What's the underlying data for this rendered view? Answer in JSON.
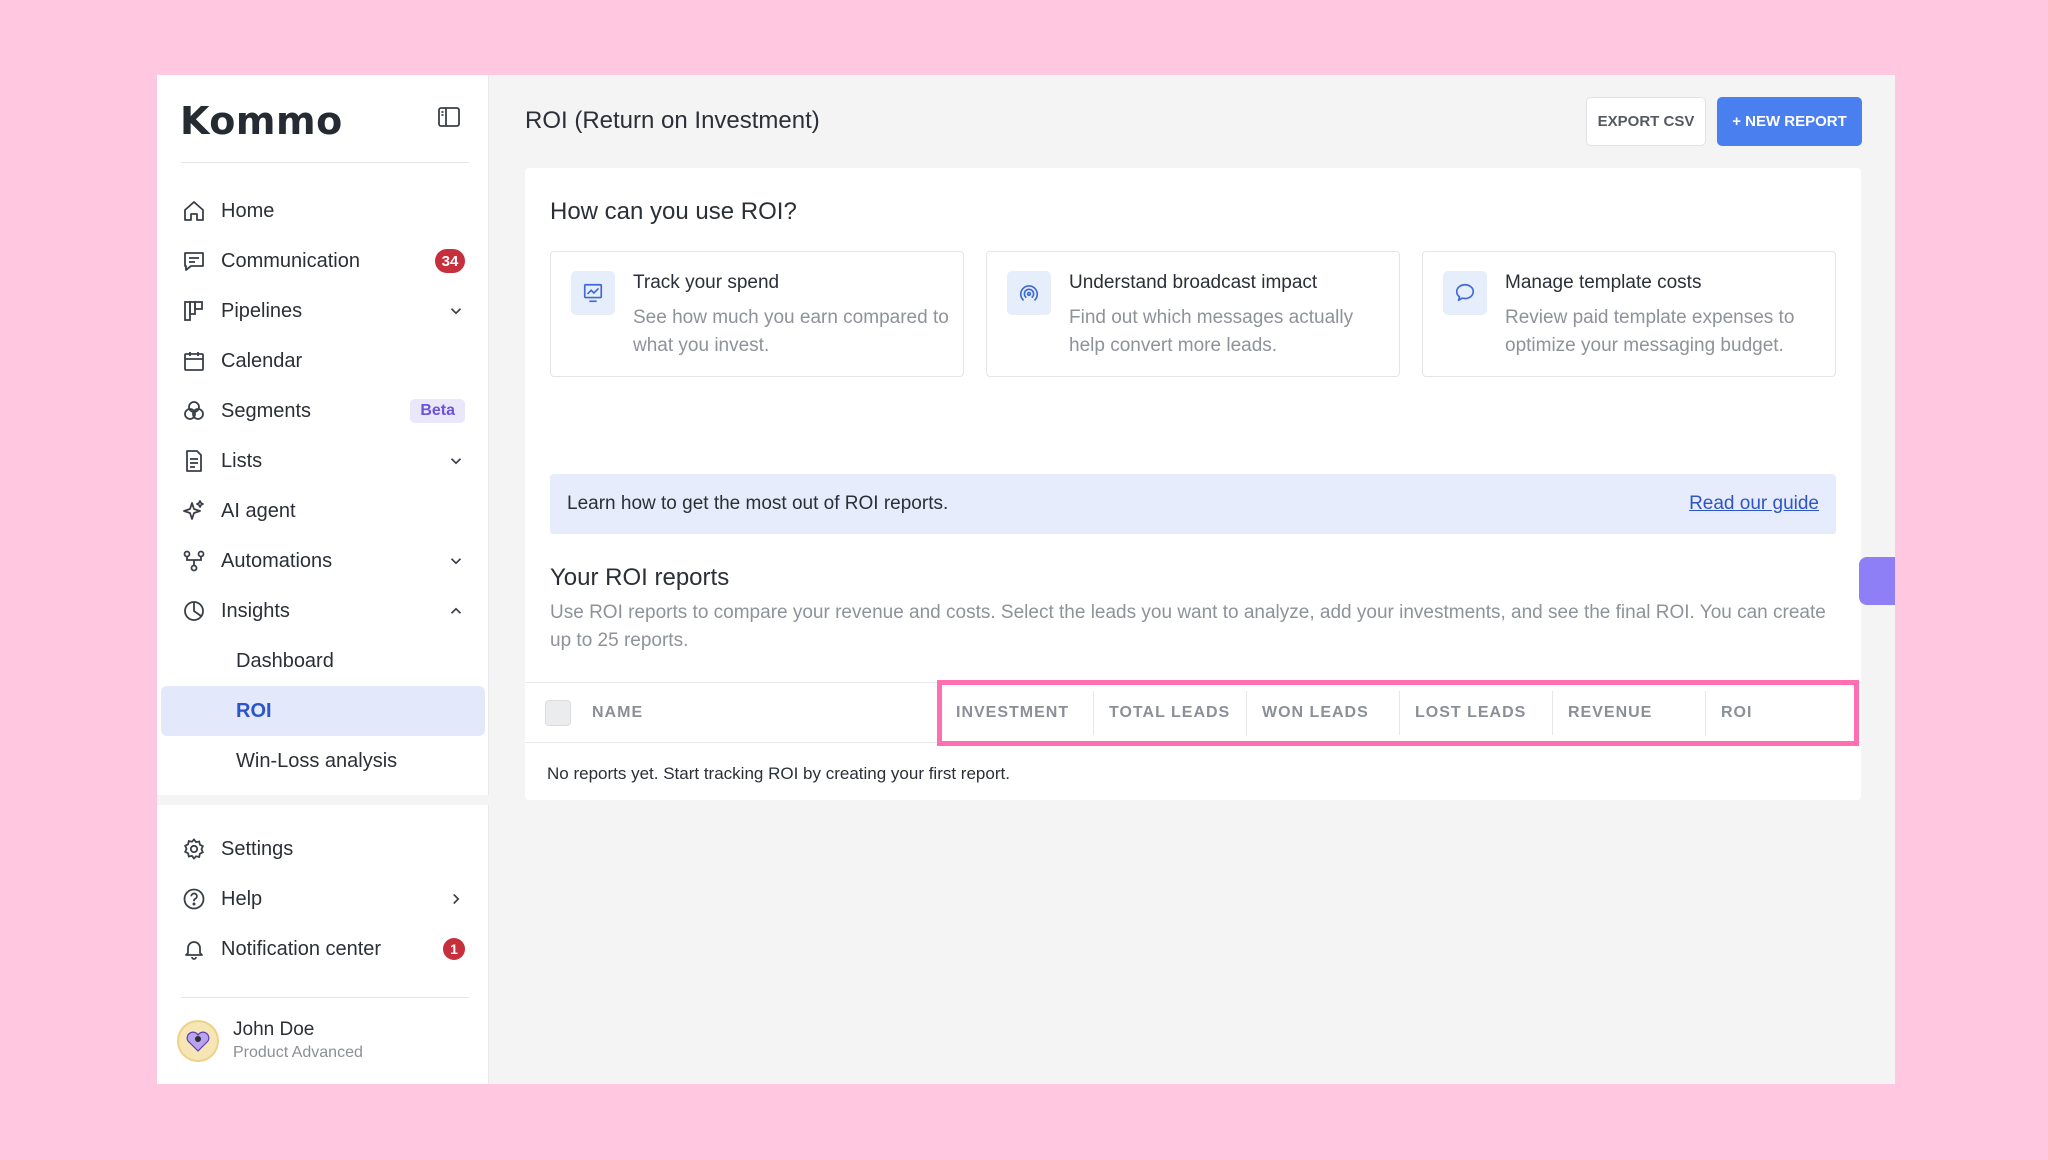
{
  "brand": {
    "logo_text": "Kommo"
  },
  "sidebar": {
    "nav": [
      {
        "label": "Home",
        "icon": "home-icon"
      },
      {
        "label": "Communication",
        "icon": "chat-icon",
        "badge": "34"
      },
      {
        "label": "Pipelines",
        "icon": "pipelines-icon"
      },
      {
        "label": "Calendar",
        "icon": "calendar-icon"
      },
      {
        "label": "Segments",
        "icon": "segments-icon",
        "badge": "Beta"
      },
      {
        "label": "Lists",
        "icon": "lists-icon"
      },
      {
        "label": "AI agent",
        "icon": "sparkle-icon"
      },
      {
        "label": "Automations",
        "icon": "automations-icon"
      },
      {
        "label": "Insights",
        "icon": "insights-icon"
      }
    ],
    "insights_sub": [
      {
        "label": "Dashboard"
      },
      {
        "label": "ROI"
      },
      {
        "label": "Win-Loss analysis"
      }
    ],
    "bottom": [
      {
        "label": "Settings",
        "icon": "gear-icon"
      },
      {
        "label": "Help",
        "icon": "help-icon"
      },
      {
        "label": "Notification center",
        "icon": "bell-icon",
        "badge": "1"
      }
    ],
    "user": {
      "name": "John Doe",
      "role": "Product Advanced"
    }
  },
  "header": {
    "title": "ROI (Return on Investment)",
    "export_label": "EXPORT CSV",
    "new_report_label": "+ NEW REPORT"
  },
  "intro": {
    "title": "How can you use ROI?",
    "features": [
      {
        "title": "Track your spend",
        "desc": "See how much you earn compared to what you invest."
      },
      {
        "title": "Understand broadcast impact",
        "desc": "Find out which messages actually help convert more leads."
      },
      {
        "title": "Manage template costs",
        "desc": "Review paid template expenses to optimize your messaging budget."
      }
    ],
    "info_text": "Learn how to get the most out of ROI reports.",
    "info_link": "Read our guide"
  },
  "reports": {
    "title": "Your ROI reports",
    "description": "Use ROI reports to compare your revenue and costs. Select the leads you want to analyze, add your investments, and see the final ROI. You can create up to 25 reports.",
    "columns": [
      "NAME",
      "INVESTMENT",
      "TOTAL LEADS",
      "WON LEADS",
      "LOST LEADS",
      "REVENUE",
      "ROI"
    ],
    "empty_text": "No reports yet. Start tracking ROI by creating your first report."
  },
  "colors": {
    "accent": "#4a7ff0",
    "highlight": "#ff6fb2",
    "badge": "#c62f3c",
    "background": "#ffc8e0"
  }
}
